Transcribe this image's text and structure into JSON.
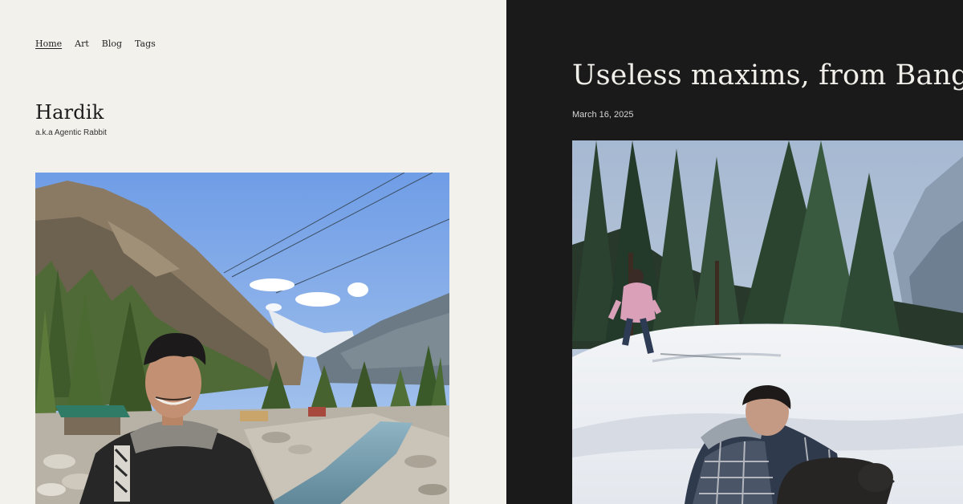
{
  "nav": {
    "items": [
      {
        "label": "Home",
        "active": true
      },
      {
        "label": "Art",
        "active": false
      },
      {
        "label": "Blog",
        "active": false
      },
      {
        "label": "Tags",
        "active": false
      }
    ]
  },
  "site": {
    "title": "Hardik",
    "tagline": "a.k.a Agentic Rabbit"
  },
  "post": {
    "title": "Useless maxims, from Bangalore",
    "date": "March 16, 2025"
  },
  "colors": {
    "left_background": "#f2f1ec",
    "right_background": "#1a1a1a",
    "sky": "#8fb3e6",
    "snow": "#eef0f2"
  }
}
